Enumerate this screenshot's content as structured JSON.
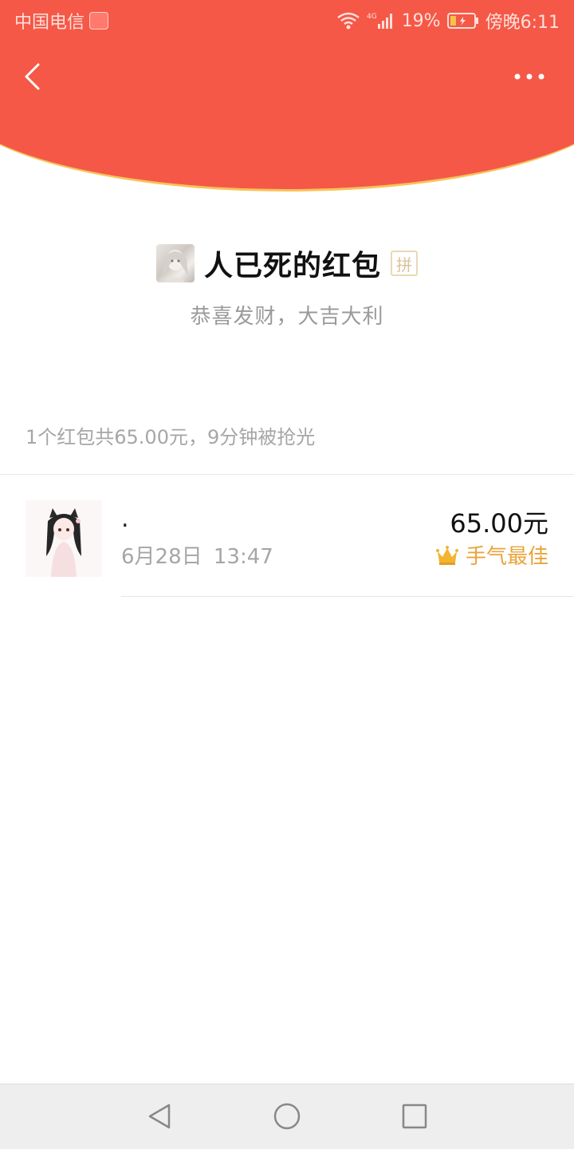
{
  "status_bar": {
    "carrier": "中国电信",
    "network": "4G",
    "battery": "19%",
    "time": "傍晚6:11"
  },
  "header": {
    "background_color": "#f55847",
    "accent_border_color": "#f6c35a",
    "back_icon": "chevron-left-icon",
    "more_icon": "more-dots-icon"
  },
  "sender": {
    "name": "人已死的红包",
    "badge": "拼",
    "greeting": "恭喜发财，大吉大利"
  },
  "summary": "1个红包共65.00元，9分钟被抢光",
  "receivers": [
    {
      "name": ".",
      "time": "6月28日 13:47",
      "amount": "65.00元",
      "badge_label": "手气最佳",
      "badge_icon": "crown-icon",
      "badge_color": "#eaa43a"
    }
  ],
  "nav_bar": {
    "back_icon": "triangle-back-icon",
    "home_icon": "circle-home-icon",
    "recent_icon": "square-recent-icon"
  }
}
